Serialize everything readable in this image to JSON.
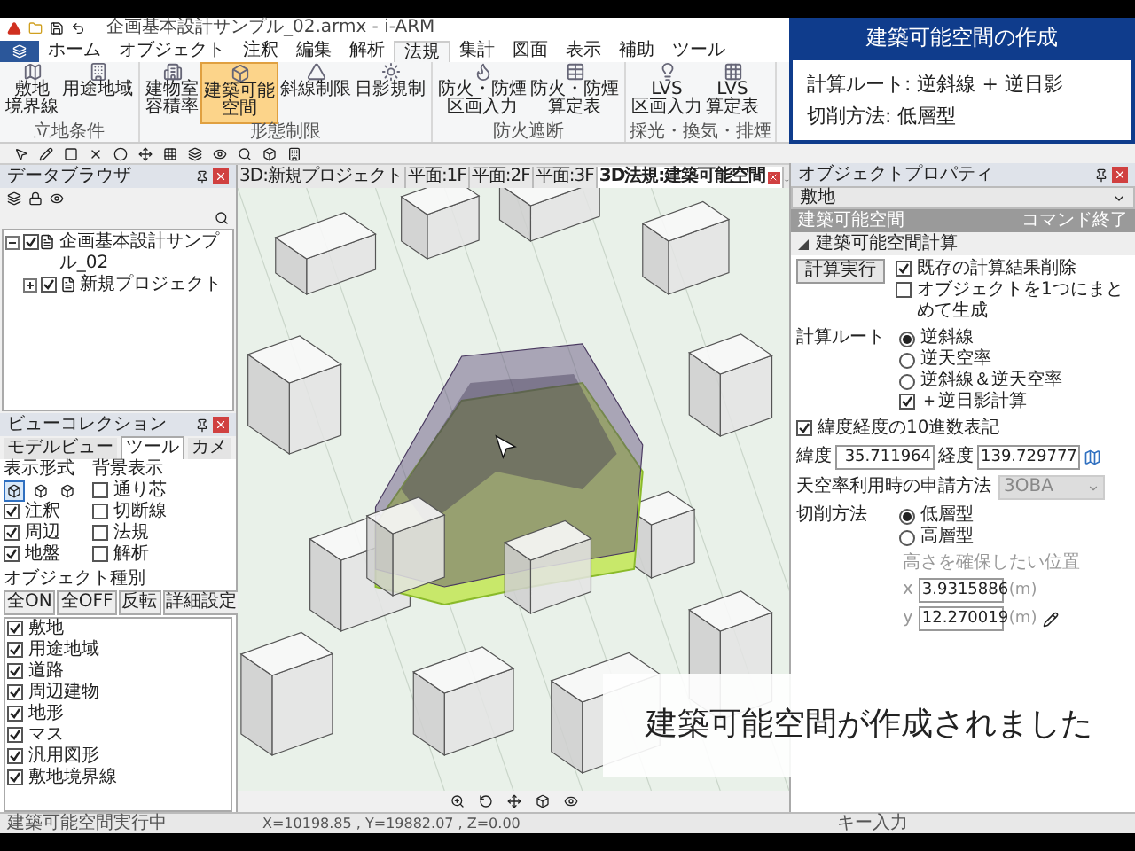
{
  "title_bar": {
    "title": "企画基本設計サンプル_02.armx - i-ARM"
  },
  "menu_tabs": [
    {
      "label": "ホーム",
      "selected": false
    },
    {
      "label": "オブジェクト",
      "selected": false
    },
    {
      "label": "注釈",
      "selected": false
    },
    {
      "label": "編集",
      "selected": false
    },
    {
      "label": "解析",
      "selected": false
    },
    {
      "label": "法規",
      "selected": true
    },
    {
      "label": "集計",
      "selected": false
    },
    {
      "label": "図面",
      "selected": false
    },
    {
      "label": "表示",
      "selected": false
    },
    {
      "label": "補助",
      "selected": false
    },
    {
      "label": "ツール",
      "selected": false
    }
  ],
  "ribbon_groups": [
    {
      "label": "立地条件",
      "buttons": [
        {
          "lines": [
            "敷地",
            "境界線"
          ],
          "selected": false
        },
        {
          "lines": [
            "用途地域"
          ],
          "selected": false
        }
      ]
    },
    {
      "label": "形態制限",
      "buttons": [
        {
          "lines": [
            "建物室",
            "容積率"
          ],
          "selected": false
        },
        {
          "lines": [
            "建築可能",
            "空間"
          ],
          "selected": true
        },
        {
          "lines": [
            "斜線制限"
          ],
          "selected": false
        },
        {
          "lines": [
            "日影規制"
          ],
          "selected": false
        }
      ]
    },
    {
      "label": "防火遮断",
      "buttons": [
        {
          "lines": [
            "防火・防煙",
            "区画入力"
          ],
          "selected": false
        },
        {
          "lines": [
            "防火・防煙",
            "算定表"
          ],
          "selected": false
        }
      ]
    },
    {
      "label": "採光・換気・排煙",
      "buttons": [
        {
          "lines": [
            "LVS",
            "区画入力"
          ],
          "selected": false
        },
        {
          "lines": [
            "LVS",
            "算定表"
          ],
          "selected": false
        }
      ]
    }
  ],
  "overlay": {
    "title": "建築可能空間の作成",
    "lines": [
      "計算ルート: 逆斜線 + 逆日影",
      "切削方法: 低層型"
    ]
  },
  "data_browser": {
    "title": "データブラウザ",
    "tree": [
      {
        "label": "企画基本設計サンプル_02",
        "checked": true,
        "expanded": true,
        "children": [
          {
            "label": "新規プロジェクト",
            "checked": true,
            "expanded": false
          }
        ]
      }
    ]
  },
  "view_collection": {
    "title": "ビューコレクション",
    "tabs": [
      {
        "label": "モデルビュー",
        "selected": false
      },
      {
        "label": "ツール",
        "selected": true
      },
      {
        "label": "カメ",
        "selected": false
      }
    ],
    "display_format": {
      "label": "表示形式",
      "modes": [
        {
          "selected": true
        },
        {
          "selected": false
        },
        {
          "selected": false
        }
      ],
      "options": [
        {
          "label": "注釈",
          "checked": true
        },
        {
          "label": "周辺",
          "checked": true
        },
        {
          "label": "地盤",
          "checked": true
        }
      ]
    },
    "background": {
      "label": "背景表示",
      "options": [
        {
          "label": "通り芯",
          "checked": false
        },
        {
          "label": "切断線",
          "checked": false
        },
        {
          "label": "法規",
          "checked": false
        },
        {
          "label": "解析",
          "checked": false
        }
      ]
    },
    "object_types": {
      "label": "オブジェクト種別",
      "buttons": [
        "全ON",
        "全OFF",
        "反転",
        "詳細設定"
      ],
      "items": [
        {
          "label": "敷地",
          "checked": true
        },
        {
          "label": "用途地域",
          "checked": true
        },
        {
          "label": "道路",
          "checked": true
        },
        {
          "label": "周辺建物",
          "checked": true
        },
        {
          "label": "地形",
          "checked": true
        },
        {
          "label": "マス",
          "checked": true
        },
        {
          "label": "汎用図形",
          "checked": true
        },
        {
          "label": "敷地境界線",
          "checked": true
        }
      ]
    }
  },
  "view_tabs": [
    {
      "label": "3D:新規プロジェクト",
      "selected": false
    },
    {
      "label": "平面:1F",
      "selected": false
    },
    {
      "label": "平面:2F",
      "selected": false
    },
    {
      "label": "平面:3F",
      "selected": false
    },
    {
      "label": "3D法規:建築可能空間",
      "selected": true
    }
  ],
  "caption": "建築可能空間が作成されました",
  "properties": {
    "title": "オブジェクトプロパティ",
    "object_select": "敷地",
    "command_bar": {
      "title": "建築可能空間",
      "end": "コマンド終了"
    },
    "section": {
      "title": "建築可能空間計算",
      "expanded": true
    },
    "run_button": "計算実行",
    "options": [
      {
        "label": "既存の計算結果削除",
        "checked": true
      },
      {
        "label": "オブジェクトを1つにまとめて生成",
        "checked": false
      }
    ],
    "route": {
      "label": "計算ルート",
      "choices": [
        {
          "label": "逆斜線",
          "selected": true
        },
        {
          "label": "逆天空率",
          "selected": false
        },
        {
          "label": "逆斜線＆逆天空率",
          "selected": false
        }
      ],
      "shadow": {
        "label": "＋逆日影計算",
        "checked": true
      }
    },
    "decimal": {
      "label": "緯度経度の10進数表記",
      "checked": true
    },
    "latitude": {
      "label": "緯度",
      "value": "35.711964"
    },
    "longitude": {
      "label": "経度",
      "value": "139.729777"
    },
    "sky_method": {
      "label": "天空率利用時の申請方法",
      "value": "3OBA",
      "disabled": true
    },
    "cut": {
      "label": "切削方法",
      "choices": [
        {
          "label": "低層型",
          "selected": true
        },
        {
          "label": "高層型",
          "selected": false
        }
      ]
    },
    "position": {
      "label": "高さを確保したい位置",
      "coords": [
        {
          "label": "x",
          "value": "3.9315886",
          "unit": "(m)"
        },
        {
          "label": "y",
          "value": "12.270019",
          "unit": "(m)"
        }
      ]
    }
  },
  "status_bar": {
    "message": "建築可能空間実行中",
    "coordinates": "X=10198.85 , Y=19882.07 , Z=0.00",
    "input": "キー入力"
  }
}
